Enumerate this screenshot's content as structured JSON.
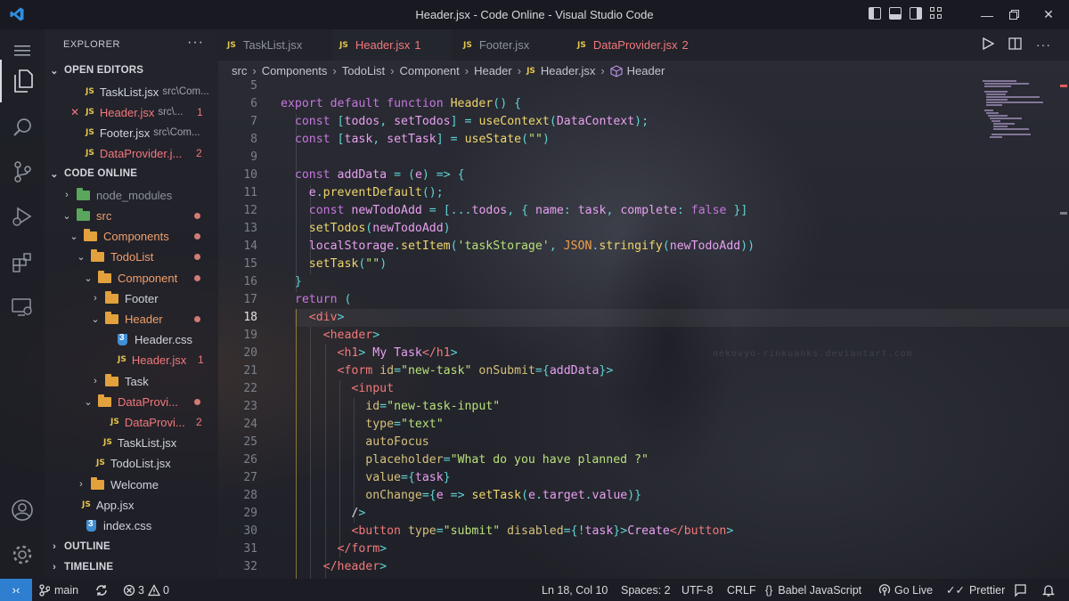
{
  "window": {
    "title": "Header.jsx - Code Online - Visual Studio Code"
  },
  "explorer": {
    "title": "EXPLORER",
    "more": "···",
    "open_editors": {
      "label": "OPEN EDITORS",
      "items": [
        {
          "icon": "JS",
          "name": "TaskList.jsx",
          "path": "src\\Com...",
          "modified": false,
          "badge": ""
        },
        {
          "icon": "JS",
          "name": "Header.jsx",
          "path": "src\\...",
          "modified": true,
          "badge": "1",
          "close": "✕"
        },
        {
          "icon": "JS",
          "name": "Footer.jsx",
          "path": "src\\Com...",
          "modified": false,
          "badge": ""
        },
        {
          "icon": "JS",
          "name": "DataProvider.j...",
          "path": "",
          "modified": false,
          "badge": "2"
        }
      ]
    },
    "workspace": {
      "label": "CODE ONLINE",
      "tree": [
        {
          "name": "node_modules",
          "type": "folder",
          "color": "green",
          "depth": 1,
          "open": false
        },
        {
          "name": "src",
          "type": "folder",
          "color": "green",
          "depth": 1,
          "open": true
        },
        {
          "name": "Components",
          "type": "folder",
          "depth": 2,
          "open": true
        },
        {
          "name": "TodoList",
          "type": "folder",
          "depth": 3,
          "open": true
        },
        {
          "name": "Component",
          "type": "folder",
          "depth": 4,
          "open": true
        },
        {
          "name": "Footer",
          "type": "folder",
          "depth": 5,
          "open": false
        },
        {
          "name": "Header",
          "type": "folder",
          "depth": 5,
          "open": true
        },
        {
          "name": "Header.css",
          "type": "css",
          "depth": 6
        },
        {
          "name": "Header.jsx",
          "type": "js",
          "depth": 6,
          "badge": "1"
        },
        {
          "name": "Task",
          "type": "folder",
          "depth": 5,
          "open": false
        },
        {
          "name": "DataProvi...",
          "type": "folder",
          "depth": 4,
          "open": true
        },
        {
          "name": "DataProvi...",
          "type": "js",
          "depth": 5,
          "badge": "2"
        },
        {
          "name": "TaskList.jsx",
          "type": "js",
          "depth": 4
        },
        {
          "name": "TodoList.jsx",
          "type": "js",
          "depth": 3
        },
        {
          "name": "Welcome",
          "type": "folder",
          "depth": 2,
          "open": false
        },
        {
          "name": "App.jsx",
          "type": "js",
          "depth": 1
        },
        {
          "name": "index.css",
          "type": "css",
          "depth": 1
        }
      ]
    },
    "outline_label": "OUTLINE",
    "timeline_label": "TIMELINE"
  },
  "tabs": [
    {
      "icon": "JS",
      "label": "TaskList.jsx",
      "active": false,
      "badge": ""
    },
    {
      "icon": "JS",
      "label": "Header.jsx",
      "active": true,
      "badge": "1"
    },
    {
      "icon": "JS",
      "label": "Footer.jsx",
      "active": false,
      "badge": ""
    },
    {
      "icon": "JS",
      "label": "DataProvider.jsx",
      "active": false,
      "badge": "2"
    }
  ],
  "breadcrumb": {
    "parts": [
      "src",
      "Components",
      "TodoList",
      "Component",
      "Header"
    ],
    "file": "Header.jsx",
    "symbol": "Header"
  },
  "editor": {
    "first_line": 5,
    "current_line": 18,
    "lines": [
      "",
      "export default function Header() {",
      "  const [todos, setTodos] = useContext(DataContext);",
      "  const [task, setTask] = useState(\"\")",
      "",
      "  const addData = (e) => {",
      "    e.preventDefault();",
      "    const newTodoAdd = [...todos, { name: task, complete: false }]",
      "    setTodos(newTodoAdd)",
      "    localStorage.setItem('taskStorage', JSON.stringify(newTodoAdd))",
      "    setTask(\"\")",
      "  }",
      "  return (",
      "    <div>",
      "      <header>",
      "        <h1> My Task</h1>",
      "        <form id=\"new-task\" onSubmit={addData}>",
      "          <input",
      "            id=\"new-task-input\"",
      "            type=\"text\"",
      "            autoFocus",
      "            placeholder=\"What do you have planned ?\"",
      "            value={task}",
      "            onChange={e => setTask(e.target.value)}",
      "          />",
      "          <button type=\"submit\" disabled={!task}>Create</button>",
      "        </form>",
      "      </header>"
    ]
  },
  "status": {
    "branch": "main",
    "errors": "3",
    "warnings": "0",
    "position": "Ln 18, Col 10",
    "spaces": "Spaces: 2",
    "encoding": "UTF-8",
    "eol": "CRLF",
    "language": "Babel JavaScript",
    "golive": "Go Live",
    "prettier": "Prettier"
  },
  "watermark": "nekovyo-rinkuanks.deviantart.com",
  "colors": {
    "accent_blue": "#2f7fd0",
    "js_yellow": "#e5c54b",
    "modified_orange": "#f0a06b",
    "error_red": "#f2787d"
  }
}
